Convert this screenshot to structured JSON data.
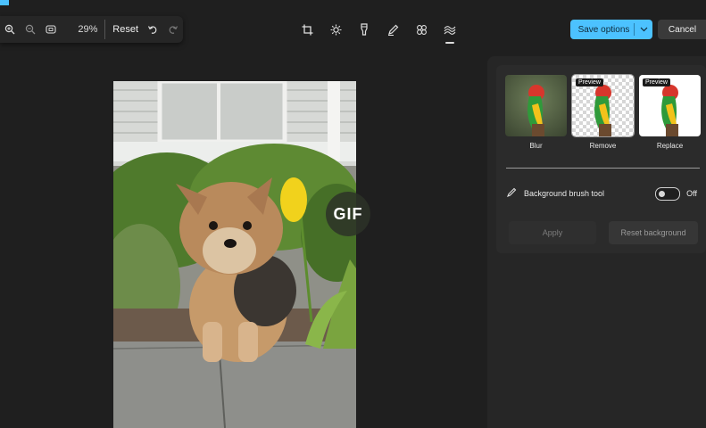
{
  "zoom_toolbar": {
    "zoom_level": "29%",
    "reset_label": "Reset"
  },
  "edit_tools": [
    "crop-icon",
    "brightness-icon",
    "markup-icon",
    "draw-icon",
    "filter-icon",
    "background-icon"
  ],
  "header_actions": {
    "save_label": "Save options",
    "cancel_label": "Cancel"
  },
  "photo_overlay": {
    "gif_badge": "GIF"
  },
  "background_panel": {
    "options": [
      {
        "label": "Blur",
        "tag": ""
      },
      {
        "label": "Remove",
        "tag": "Preview"
      },
      {
        "label": "Replace",
        "tag": "Preview"
      }
    ],
    "brush_tool_label": "Background brush tool",
    "brush_toggle_state": "Off",
    "apply_label": "Apply",
    "reset_background_label": "Reset background"
  },
  "colors": {
    "accent": "#4cc2ff",
    "background": "#1f1f1f",
    "panel": "#262626"
  }
}
